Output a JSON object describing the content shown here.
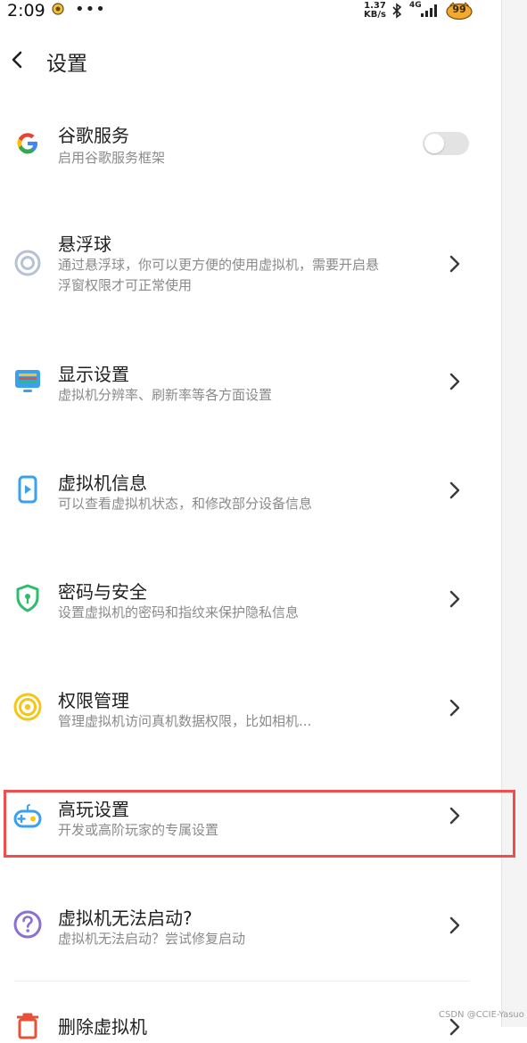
{
  "status_bar": {
    "time": "2:09",
    "more": "•••",
    "speed_value": "1.37",
    "speed_unit": "KB/s",
    "network": "4G",
    "battery_level": "99"
  },
  "header": {
    "title": "设置"
  },
  "settings": {
    "google": {
      "title": "谷歌服务",
      "desc": "启用谷歌服务框架",
      "enabled": false
    },
    "float_ball": {
      "title": "悬浮球",
      "desc_line1": "通过悬浮球，你可以更方便的使用虚拟机，需要开启悬",
      "desc_line2": "浮窗权限才可正常使用"
    },
    "display": {
      "title": "显示设置",
      "desc": "虚拟机分辨率、刷新率等各方面设置"
    },
    "vm_info": {
      "title": "虚拟机信息",
      "desc": "可以查看虚拟机状态，和修改部分设备信息"
    },
    "security": {
      "title": "密码与安全",
      "desc": "设置虚拟机的密码和指纹来保护隐私信息"
    },
    "permissions": {
      "title": "权限管理",
      "desc": "管理虚拟机访问真机数据权限，比如相机..."
    },
    "advanced": {
      "title": "高玩设置",
      "desc": "开发或高阶玩家的专属设置"
    },
    "cannot_start": {
      "title": "虚拟机无法启动?",
      "desc": "虚拟机无法启动？尝试修复启动"
    },
    "delete_vm": {
      "title": "删除虚拟机"
    }
  },
  "watermark": "CSDN @CCIE-Yasuo",
  "colors": {
    "highlight": "#f04e4e",
    "blue_icon": "#3aa0f0",
    "green_icon": "#2ebd6b",
    "yellow_icon": "#f5c518",
    "purple_icon": "#8b6fd6",
    "red_icon": "#e8503a"
  }
}
